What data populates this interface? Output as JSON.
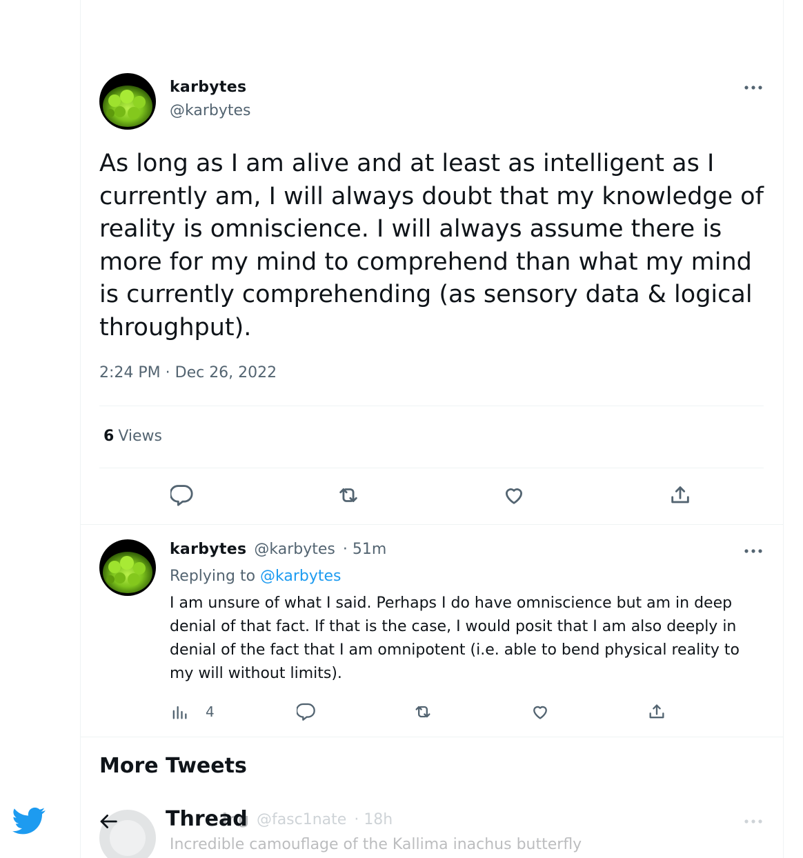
{
  "main_tweet": {
    "name": "karbytes",
    "handle": "@karbytes",
    "text": "As long as I am alive and at least as intelligent as I currently am, I will always doubt that my knowledge of reality is omniscience. I will always assume there is more for my mind to comprehend than what my mind is currently comprehending (as sensory data & logical throughput).",
    "timestamp": "2:24 PM · Dec 26, 2022",
    "views_count": "6",
    "views_label": "Views"
  },
  "reply_tweet": {
    "name": "karbytes",
    "handle": "@karbytes",
    "time": "· 51m",
    "replying_to_label": "Replying to",
    "replying_to_handle": "@karbytes",
    "text": "I am unsure of what I said. Perhaps I do have omniscience but am in deep denial of that fact. If that is the case, I would posit that I am also deeply in denial of the fact that I am omnipotent (i.e. able to bend physical reality to my will without limits).",
    "views_count": "4"
  },
  "more_tweets": {
    "heading": "More Tweets",
    "next_name": "ing",
    "next_handle": "@fasc1nate",
    "next_time": "· 18h",
    "next_text": "Incredible camouflage of the Kallima inachus butterfly"
  },
  "thread_header": {
    "title": "Thread"
  },
  "colors": {
    "text_primary": "#0f1419",
    "text_secondary": "#536471",
    "accent": "#1d9bf0",
    "divider": "#eff3f4"
  },
  "icons": [
    "more-icon",
    "reply-icon",
    "retweet-icon",
    "like-icon",
    "share-icon",
    "views-icon",
    "back-arrow-icon",
    "twitter-bird-icon"
  ]
}
